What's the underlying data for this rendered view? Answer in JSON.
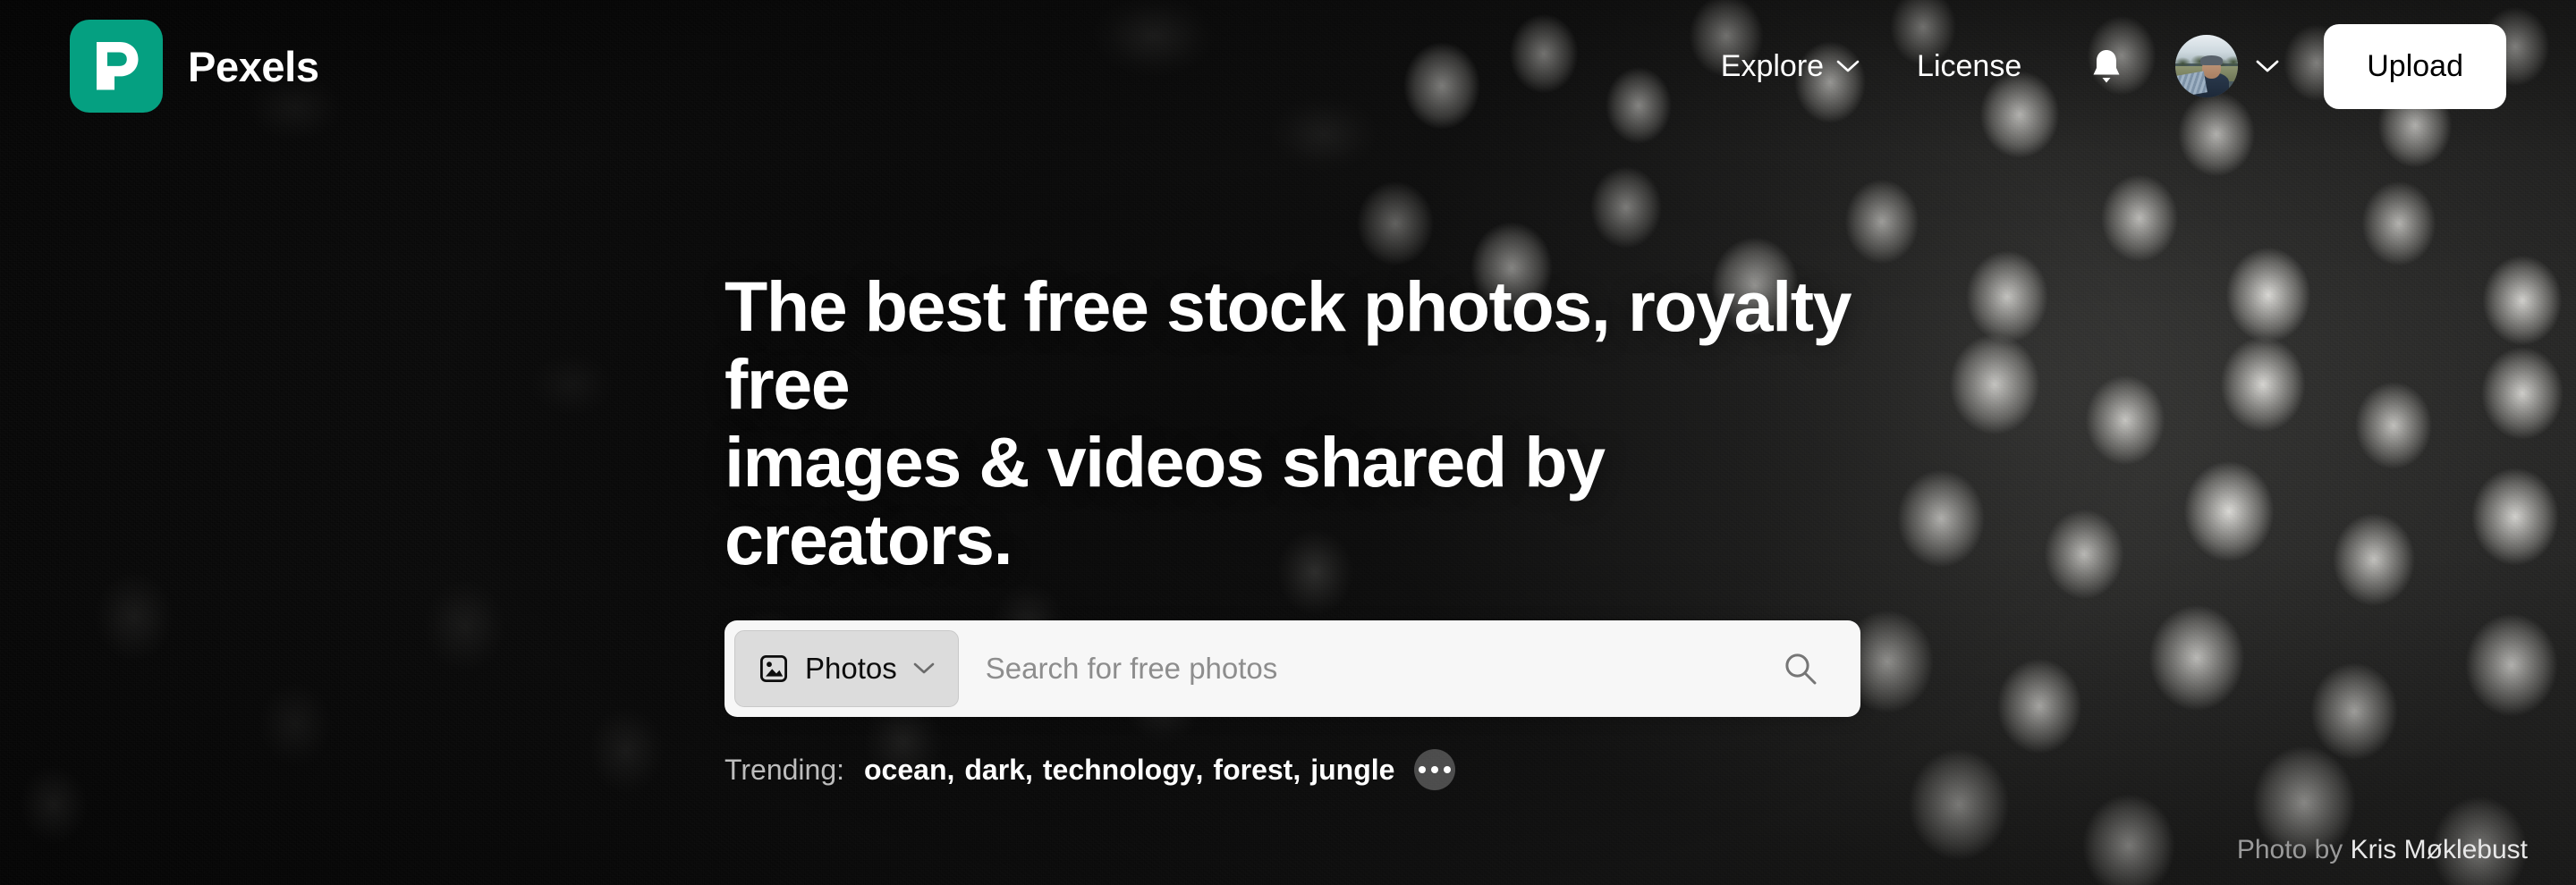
{
  "site": {
    "brand_name": "Pexels",
    "logo_color": "#05A081",
    "logo_icon": "pexels-p-logo-icon"
  },
  "header": {
    "nav": [
      {
        "label": "Explore",
        "icon": "chevron-down-icon",
        "has_chevron": true
      },
      {
        "label": "License",
        "has_chevron": false
      }
    ],
    "notifications_icon": "bell-icon",
    "avatar_icon": "user-avatar",
    "avatar_chevron_icon": "chevron-down-icon",
    "upload_label": "Upload"
  },
  "hero": {
    "headline_line1": "The best free stock photos, royalty free",
    "headline_line2": "images & videos shared by creators.",
    "search": {
      "type_label": "Photos",
      "type_icon": "image-icon",
      "type_chevron_icon": "chevron-down-icon",
      "placeholder": "Search for free photos",
      "value": "",
      "submit_icon": "search-icon"
    },
    "trending": {
      "label": "Trending:",
      "tags": [
        "ocean",
        "dark",
        "technology",
        "forest",
        "jungle"
      ],
      "more_icon": "ellipsis-icon"
    }
  },
  "credit": {
    "prefix": "Photo by",
    "photographer": "Kris Møklebust"
  }
}
